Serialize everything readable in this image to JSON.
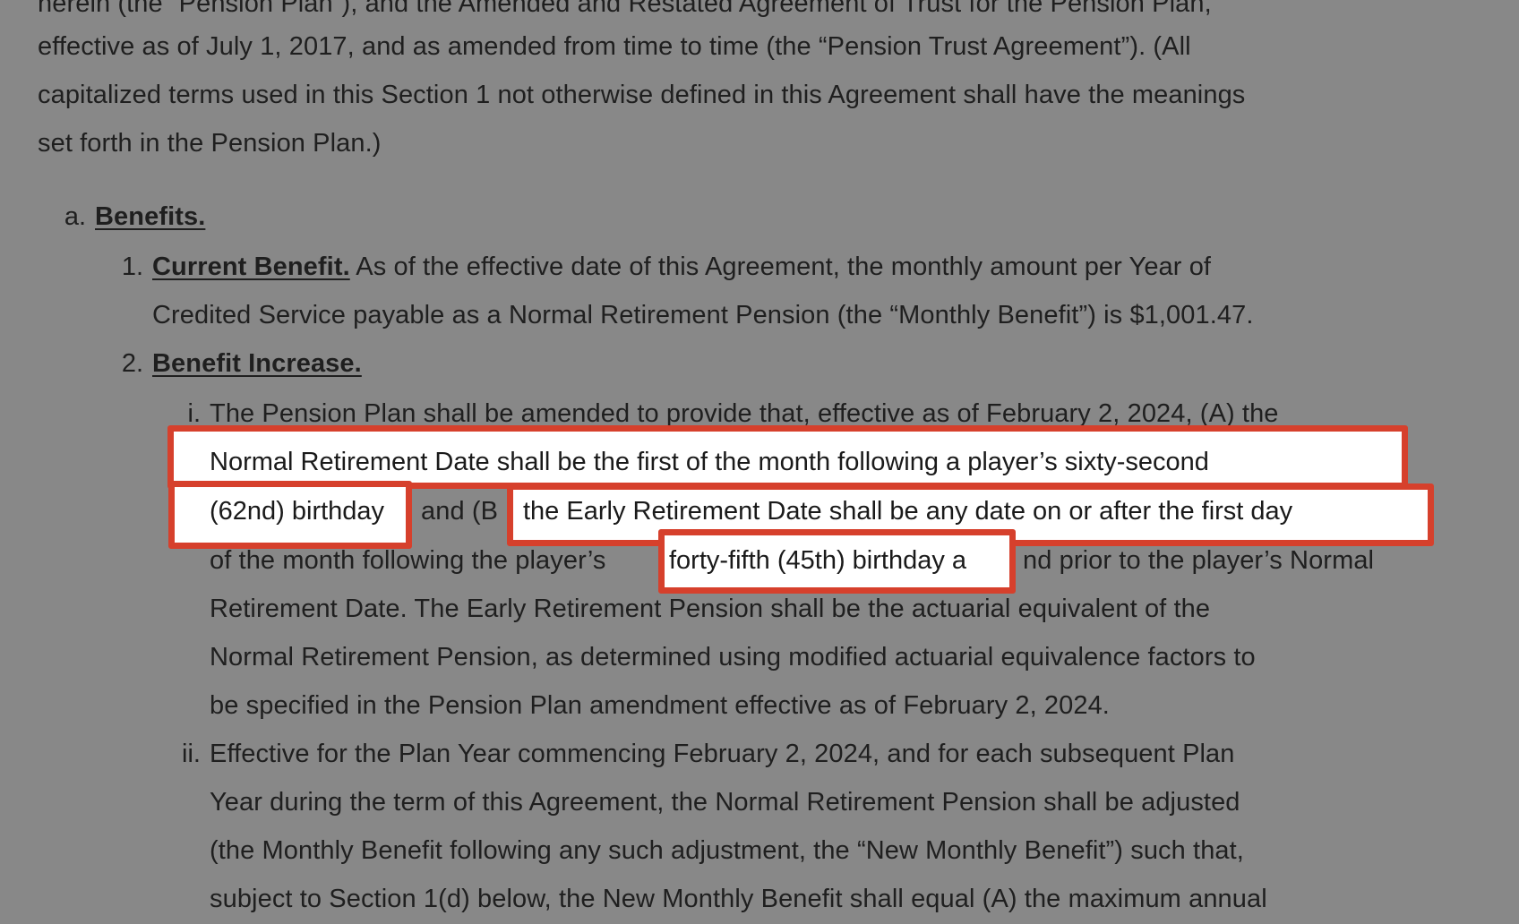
{
  "intro_lines": [
    "herein (the “Pension Plan”), and the Amended and Restated Agreement of Trust for the Pension Plan,",
    "effective as of July 1, 2017, and as amended from time to time (the “Pension Trust Agreement”). (All",
    "capitalized terms used in this Section 1 not otherwise defined in this Agreement shall have the meanings",
    "set forth in the Pension Plan.)"
  ],
  "section_a": {
    "marker": "a.",
    "heading": "Benefits."
  },
  "item_1": {
    "marker": "1.",
    "heading": "Current Benefit.",
    "line1_rest": " As of the effective date of this Agreement, the monthly amount per Year of",
    "line2": "Credited Service payable as a Normal Retirement Pension (the “Monthly Benefit”) is $1,001.47."
  },
  "item_2": {
    "marker": "2.",
    "heading": "Benefit Increase."
  },
  "item_i": {
    "marker": "i.",
    "line1": "The Pension Plan shall be amended to provide that, effective as of February 2, 2024, (A) the",
    "line2_highlight": "Normal Retirement Date shall be the first of the month following a player’s sixty-second",
    "line3_hl1": "(62nd) birthday",
    "line3_mid": "and (B",
    "line3_hl2": "the Early Retirement Date shall be any date on or after the first day",
    "line4_pre": "of the month following the player’s",
    "line4_hl": "forty-fifth (45th) birthday",
    "line4_hl_tail": "a",
    "line4_post": "nd prior to the player’s Normal",
    "line5": "Retirement Date. The Early Retirement Pension shall be the actuarial equivalent of the",
    "line6": "Normal Retirement Pension, as determined using modified actuarial equivalence factors to",
    "line7": "be specified in the Pension Plan amendment effective as of February 2, 2024."
  },
  "item_ii": {
    "marker": "ii.",
    "lines": [
      "Effective for the Plan Year commencing February 2, 2024, and for each subsequent Plan",
      "Year during the term of this Agreement, the Normal Retirement Pension shall be adjusted",
      "(the Monthly Benefit following any such adjustment, the “New Monthly Benefit”) such that,",
      "subject to Section 1(d) below, the New Monthly Benefit shall equal (A) the maximum annual"
    ]
  },
  "colors": {
    "overlay_gray": "#888888",
    "highlight_border": "#d6402c",
    "highlight_fill": "#ffffff"
  }
}
